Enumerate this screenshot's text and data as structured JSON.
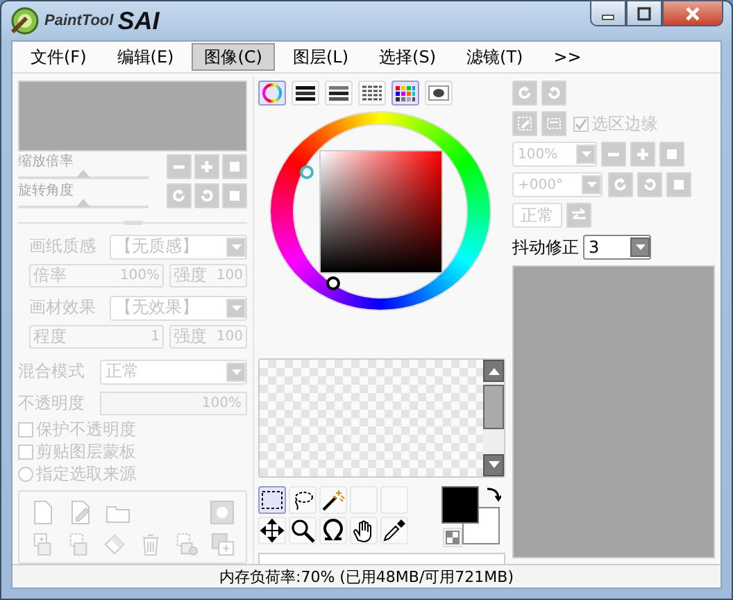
{
  "window": {
    "logo_small": "PaintTool",
    "logo_big": "SAI"
  },
  "menu": [
    {
      "label": "文件(F)",
      "selected": false
    },
    {
      "label": "编辑(E)",
      "selected": false
    },
    {
      "label": "图像(C)",
      "selected": true
    },
    {
      "label": "图层(L)",
      "selected": false
    },
    {
      "label": "选择(S)",
      "selected": false
    },
    {
      "label": "滤镜(T)",
      "selected": false
    },
    {
      "label": ">>",
      "selected": false
    }
  ],
  "navigator": {
    "disabled": true,
    "zoom": {
      "label": "缩放倍率",
      "level": 0.5
    },
    "rotate": {
      "label": "旋转角度",
      "level": 0.5
    }
  },
  "texture": {
    "disabled": true,
    "paper_label": "画纸质感",
    "paper_value": "【无质感】",
    "paper_scale_label": "倍率",
    "paper_scale": "100%",
    "paper_strength_label": "强度",
    "paper_strength": "100",
    "effect_label": "画材效果",
    "effect_value": "【无效果】",
    "effect_degree_label": "程度",
    "effect_degree": "1",
    "effect_strength_label": "强度",
    "effect_strength": "100"
  },
  "layer": {
    "disabled": true,
    "blend_label": "混合模式",
    "blend_value": "正常",
    "opacity_label": "不透明度",
    "opacity_value": "100%",
    "options": [
      {
        "kind": "checkbox",
        "label": "保护不透明度",
        "checked": false
      },
      {
        "kind": "checkbox",
        "label": "剪贴图层蒙板",
        "checked": false
      },
      {
        "kind": "radio",
        "label": "指定选取来源",
        "checked": false
      }
    ]
  },
  "color_tabs": [
    {
      "kind": "wheel",
      "selected": true
    },
    {
      "kind": "rgb",
      "selected": false
    },
    {
      "kind": "hsv",
      "selected": false
    },
    {
      "kind": "sliders",
      "selected": false
    },
    {
      "kind": "palette",
      "selected": true
    },
    {
      "kind": "scratch",
      "selected": false
    }
  ],
  "tools": [
    {
      "kind": "select",
      "selected": true
    },
    {
      "kind": "lasso",
      "selected": false
    },
    {
      "kind": "wand",
      "selected": false
    },
    {
      "kind": "empty",
      "selected": false
    },
    {
      "kind": "empty",
      "selected": false
    },
    {
      "kind": "move",
      "selected": false
    },
    {
      "kind": "zoom",
      "selected": false
    },
    {
      "kind": "rotate",
      "selected": false
    },
    {
      "kind": "hand",
      "selected": false
    },
    {
      "kind": "picker",
      "selected": false
    }
  ],
  "view": {
    "disabled": true,
    "selection_edge": {
      "label": "选区边缘",
      "checked": true
    },
    "zoom_value": "100%",
    "angle_value": "+000°",
    "mode_button": "正常"
  },
  "stabilizer": {
    "label": "抖动修正",
    "value": "3"
  },
  "status_bar": "内存负荷率:70% (已用48MB/可用721MB)"
}
